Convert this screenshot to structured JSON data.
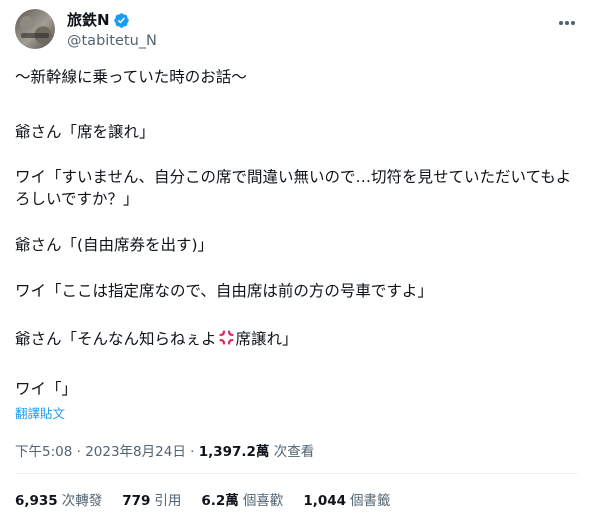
{
  "user": {
    "name": "旅鉄N",
    "handle": "@tabitetu_N"
  },
  "tweet": {
    "lines": [
      "〜新幹線に乗っていた時のお話〜",
      "爺さん「席を譲れ」",
      "ワイ「すいません、自分この席で間違い無いので…切符を見せていただいてもよろしいですか？」",
      "爺さん「(自由席券を出す)」",
      "ワイ「ここは指定席なので、自由席は前の方の号車ですよ」",
      "爺さん「そんなん知らねぇよ",
      "ワイ「」"
    ],
    "line6_tail": "席譲れ」",
    "translate_label": "翻譯貼文"
  },
  "meta": {
    "time": "下午5:08",
    "separator": " · ",
    "date": "2023年8月24日",
    "views_count": "1,397.2萬",
    "views_label": " 次查看"
  },
  "stats": {
    "retweets": {
      "count": "6,935",
      "label": "次轉發"
    },
    "quotes": {
      "count": "779",
      "label": "引用"
    },
    "likes": {
      "count": "6.2萬",
      "label": "個喜歡"
    },
    "bookmarks": {
      "count": "1,044",
      "label": "個書籤"
    }
  },
  "icons": {
    "verified": "verified-badge-icon",
    "more": "more-dots-icon",
    "anger": "anger-symbol-icon"
  },
  "colors": {
    "accent": "#1d9bf0",
    "secondary_text": "#536471",
    "anger": "#e0245e"
  }
}
